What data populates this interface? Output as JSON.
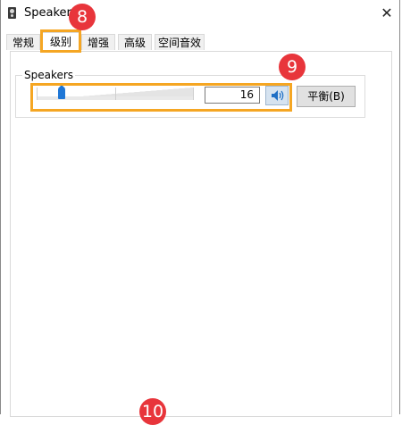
{
  "window": {
    "title": "Speakers",
    "close_glyph": "✕"
  },
  "tabs": [
    {
      "label": "常规"
    },
    {
      "label": "级别"
    },
    {
      "label": "增强"
    },
    {
      "label": "高级"
    },
    {
      "label": "空间音效"
    }
  ],
  "active_tab": "级别",
  "levels": {
    "group_label": "Speakers",
    "volume_value": "16",
    "volume_fraction": 0.16,
    "balance_label": "平衡(B)",
    "speaker_icon": "speaker-volume-icon"
  },
  "annotations": {
    "badge_8": "8",
    "badge_9": "9",
    "badge_10": "10"
  },
  "colors": {
    "highlight": "#f5a623",
    "badge": "#e8353b",
    "slider_thumb": "#1f77d6"
  }
}
